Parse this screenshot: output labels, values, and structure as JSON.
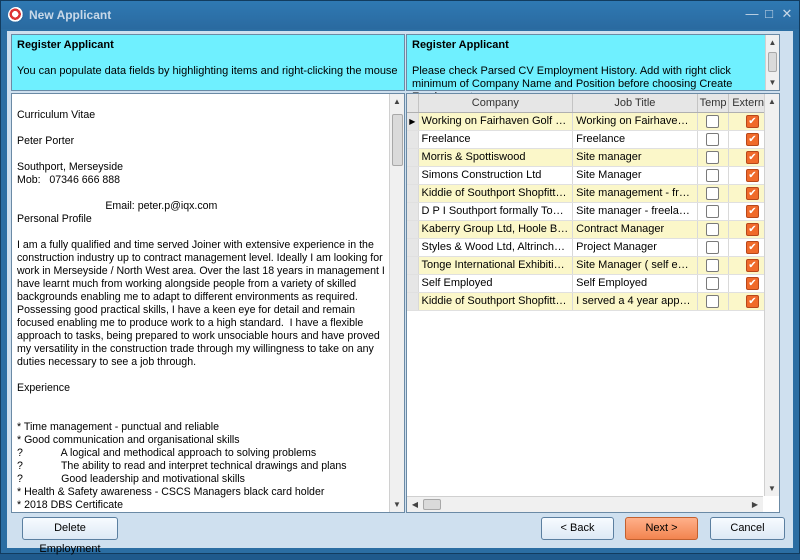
{
  "window": {
    "title": "New Applicant"
  },
  "left_panel": {
    "title": "Register Applicant",
    "description": "You can populate data fields by highlighting items and right-clicking the mouse",
    "cv_text": "Curriculum Vitae\n\nPeter Porter\n\nSouthport, Merseyside\nMob:   07346 666 888\n\n                              Email: peter.p@iqx.com\nPersonal Profile\n\nI am a fully qualified and time served Joiner with extensive experience in the construction industry up to contract management level. Ideally I am looking for work in Merseyside / North West area. Over the last 18 years in management I have learnt much from working alongside people from a variety of skilled backgrounds enabling me to adapt to different environments as required. Possessing good practical skills, I have a keen eye for detail and remain focused enabling me to produce work to a high standard.  I have a flexible approach to tasks, being prepared to work unsociable hours and have proved my versatility in the construction trade through my willingness to take on any duties necessary to see a job through.\n\nExperience\n\n\n* Time management - punctual and reliable\n* Good communication and organisational skills\n?             A logical and methodical approach to solving problems\n?             The ability to read and interpret technical drawings and plans\n?             Good leadership and motivational skills\n* Health & Safety awareness - CSCS Managers black card holder\n* 2018 DBS Certificate"
  },
  "right_panel": {
    "title": "Register Applicant",
    "description": "Please check Parsed CV Employment History.  Add with right click minimum of Company Name and Position before choosing Create Employment",
    "columns": [
      "Company",
      "Job Title",
      "Temp",
      "External"
    ],
    "rows": [
      {
        "company": "Working on Fairhaven Golf Cl...",
        "job_title": "Working on Fairhaven ...",
        "temp": false,
        "external": true
      },
      {
        "company": "Freelance",
        "job_title": "Freelance",
        "temp": false,
        "external": true
      },
      {
        "company": "Morris & Spottiswood",
        "job_title": "Site manager",
        "temp": false,
        "external": true
      },
      {
        "company": "Simons Construction Ltd",
        "job_title": "Site Manager",
        "temp": false,
        "external": true
      },
      {
        "company": "Kiddie of Southport Shopfitters",
        "job_title": "Site management - free...",
        "temp": false,
        "external": true
      },
      {
        "company": "D P I Southport formally Tong...",
        "job_title": "Site manager - freelance",
        "temp": false,
        "external": true
      },
      {
        "company": "Kaberry Group Ltd, Hoole Ba...",
        "job_title": "Contract Manager",
        "temp": false,
        "external": true
      },
      {
        "company": "Styles & Wood Ltd, Altrincham",
        "job_title": "Project Manager",
        "temp": false,
        "external": true
      },
      {
        "company": "Tonge International Exhibition...",
        "job_title": "Site Manager ( self em...",
        "temp": false,
        "external": true
      },
      {
        "company": "Self Employed",
        "job_title": "Self Employed",
        "temp": false,
        "external": true
      },
      {
        "company": "Kiddie of Southport Shopfitters",
        "job_title": "I served a 4 year appre...",
        "temp": false,
        "external": true
      }
    ]
  },
  "footer": {
    "delete_label": "Delete Employment",
    "back_label": "< Back",
    "next_label": "Next >",
    "cancel_label": "Cancel"
  },
  "colors": {
    "header_bg": "#6ff0ff",
    "window_bg": "#2b6ea3",
    "alt_row": "#fbf7c9",
    "checkbox_on": "#f06a2a",
    "next_button": "#f2844f"
  }
}
